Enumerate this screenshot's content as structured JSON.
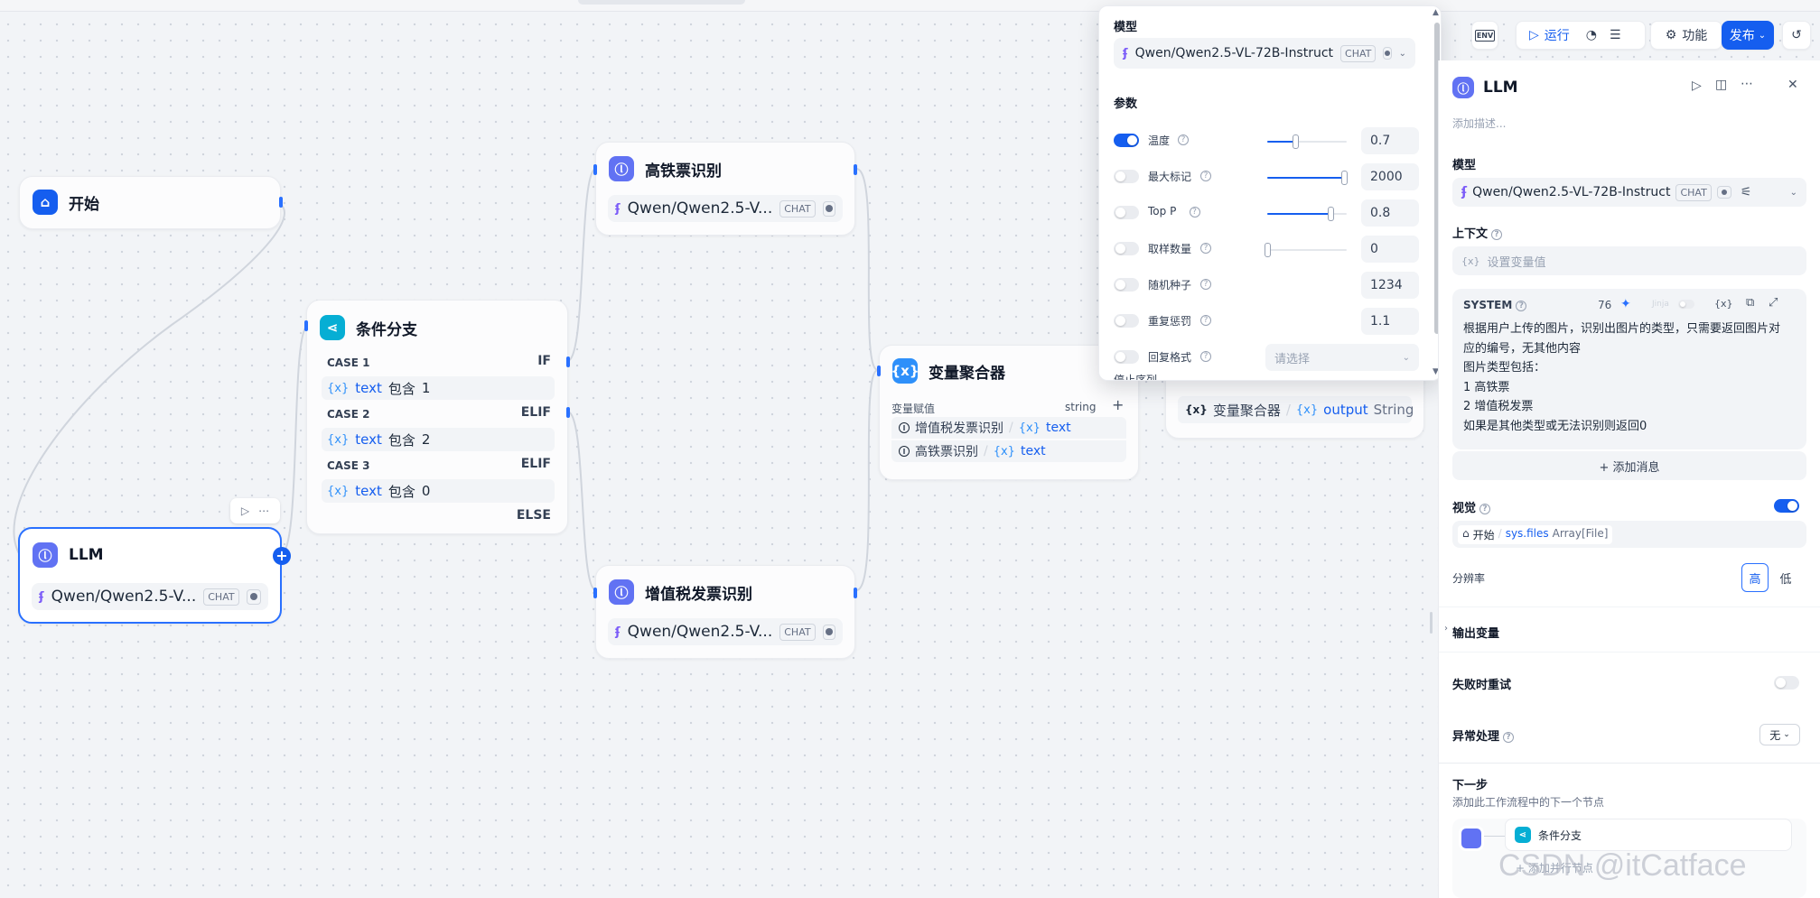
{
  "nodes": {
    "start": {
      "title": "开始"
    },
    "llm": {
      "title": "LLM",
      "model": "Qwen/Qwen2.5-V...",
      "badge": "CHAT"
    },
    "ifelse": {
      "title": "条件分支",
      "cases": [
        {
          "label": "CASE 1",
          "keyword": "IF",
          "var": "text",
          "op": "包含",
          "value": "1"
        },
        {
          "label": "CASE 2",
          "keyword": "ELIF",
          "var": "text",
          "op": "包含",
          "value": "2"
        },
        {
          "label": "CASE 3",
          "keyword": "ELIF",
          "var": "text",
          "op": "包含",
          "value": "0"
        }
      ],
      "else_label": "ELSE"
    },
    "rail": {
      "title": "高铁票识别",
      "model": "Qwen/Qwen2.5-V...",
      "badge": "CHAT"
    },
    "vat": {
      "title": "增值税发票识别",
      "model": "Qwen/Qwen2.5-V...",
      "badge": "CHAT"
    },
    "aggregator": {
      "title": "变量聚合器",
      "sub_label": "变量赋值",
      "type": "string",
      "rows": [
        {
          "node": "增值税发票识别",
          "sep": "/",
          "var": "text"
        },
        {
          "node": "高铁票识别",
          "sep": "/",
          "var": "text"
        }
      ]
    },
    "end": {
      "node": "变量聚合器",
      "sep": "/",
      "var": "output",
      "type": "String"
    }
  },
  "var_prefix": "{x}",
  "popover": {
    "model_label": "模型",
    "model": "Qwen/Qwen2.5-VL-72B-Instruct",
    "badge": "CHAT",
    "params_label": "参数",
    "params": [
      {
        "name": "温度",
        "enabled": true,
        "value": "0.7",
        "level": 0.35
      },
      {
        "name": "最大标记",
        "enabled": false,
        "value": "2000",
        "level": 0.97
      },
      {
        "name": "Top P",
        "enabled": false,
        "value": "0.8",
        "level": 0.8
      },
      {
        "name": "取样数量",
        "enabled": false,
        "value": "0",
        "level": 0.0
      },
      {
        "name": "随机种子",
        "enabled": false,
        "value": "1234"
      },
      {
        "name": "重复惩罚",
        "enabled": false,
        "value": "1.1"
      },
      {
        "name": "回复格式",
        "enabled": false,
        "select": "请选择"
      }
    ],
    "cut_label": "停止序列"
  },
  "toolbar": {
    "env": "ENV",
    "run": "运行",
    "features": "功能",
    "publish": "发布"
  },
  "panel": {
    "title": "LLM",
    "desc_placeholder": "添加描述...",
    "model_label": "模型",
    "model": "Qwen/Qwen2.5-VL-72B-Instruct",
    "badge": "CHAT",
    "context_label": "上下文",
    "context_placeholder": "设置变量值",
    "system_label": "SYSTEM",
    "token_count": "76",
    "jinja": "Jinja",
    "prompt_lines": [
      "根据用户上传的图片，识别出图片的类型，只需要返回图片对",
      "应的编号，无其他内容",
      "图片类型包括：",
      "1 高铁票",
      "2 增值税发票",
      "如果是其他类型或无法识别则返回0"
    ],
    "add_message": "+ 添加消息",
    "vision_label": "视觉",
    "vision_node": "开始",
    "vision_var": "sys.files",
    "vision_type": "Array[File]",
    "resolution_label": "分辨率",
    "res_high": "高",
    "res_low": "低",
    "output_label": "输出变量",
    "retry_label": "失败时重试",
    "error_label": "异常处理",
    "error_value": "无",
    "next_label": "下一步",
    "next_desc": "添加此工作流程中的下一个节点",
    "next_node": "条件分支",
    "add_parallel": "+ 添加并行节点"
  },
  "watermark": "CSDN @itCatface"
}
